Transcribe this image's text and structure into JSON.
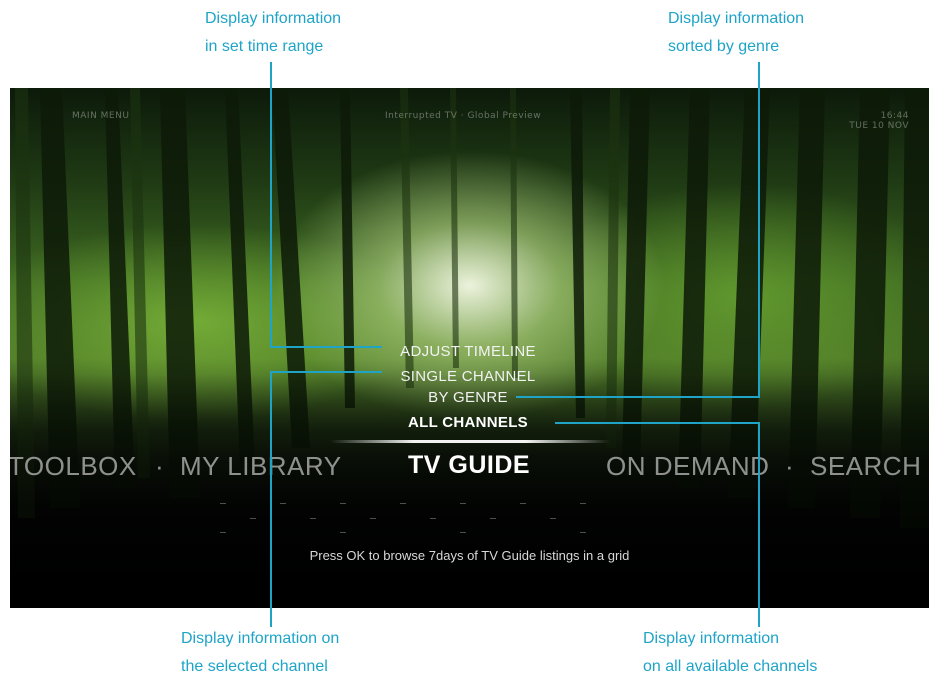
{
  "callouts": {
    "timeline": {
      "line1": "Display information",
      "line2": "in set time range"
    },
    "genre": {
      "line1": "Display information",
      "line2": "sorted by genre"
    },
    "single": {
      "line1": "Display information on",
      "line2": "the selected channel"
    },
    "all": {
      "line1": "Display information",
      "line2": "on all available channels"
    }
  },
  "screen": {
    "main_menu_label": "MAIN MENU",
    "header_info": "Interrupted TV · Global Preview",
    "clock_time": "16:44",
    "clock_date": "TUE 10 NOV"
  },
  "submenu": {
    "adjust_timeline": "ADJUST TIMELINE",
    "single_channel": "SINGLE CHANNEL",
    "by_genre": "BY GENRE",
    "all_channels": "ALL CHANNELS"
  },
  "nav": {
    "toolbox": "TOOLBOX",
    "separator": "·",
    "my_library": "MY LIBRARY",
    "tv_guide": "TV GUIDE",
    "on_demand": "ON DEMAND",
    "search": "SEARCH"
  },
  "hint": "Press OK to browse 7days of TV Guide listings in a grid",
  "colors": {
    "accent": "#1fa4c8",
    "selected_text": "#ffffff",
    "dim_text": "#8a8a8a"
  }
}
